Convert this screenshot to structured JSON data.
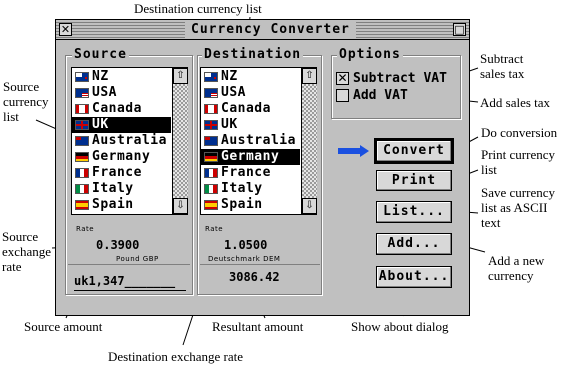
{
  "window": {
    "title": "Currency Converter",
    "close_glyph": "✕",
    "zoom_glyph": "□"
  },
  "source": {
    "label": "Source",
    "items": [
      {
        "flag": "nz-flag-icon",
        "name": "NZ"
      },
      {
        "flag": "usa-flag-icon",
        "name": "USA"
      },
      {
        "flag": "canada-flag-icon",
        "name": "Canada"
      },
      {
        "flag": "uk-flag-icon",
        "name": "UK",
        "selected": true
      },
      {
        "flag": "australia-flag-icon",
        "name": "Australia"
      },
      {
        "flag": "germany-flag-icon",
        "name": "Germany"
      },
      {
        "flag": "france-flag-icon",
        "name": "France"
      },
      {
        "flag": "italy-flag-icon",
        "name": "Italy"
      },
      {
        "flag": "spain-flag-icon",
        "name": "Spain"
      }
    ],
    "rate_label": "Rate",
    "rate_value": "0.3900",
    "currency_name": "Pound GBP",
    "amount": "uk1,347"
  },
  "destination": {
    "label": "Destination",
    "items": [
      {
        "flag": "nz-flag-icon",
        "name": "NZ"
      },
      {
        "flag": "usa-flag-icon",
        "name": "USA"
      },
      {
        "flag": "canada-flag-icon",
        "name": "Canada"
      },
      {
        "flag": "uk-flag-icon",
        "name": "UK"
      },
      {
        "flag": "australia-flag-icon",
        "name": "Australia"
      },
      {
        "flag": "germany-flag-icon",
        "name": "Germany",
        "selected": true
      },
      {
        "flag": "france-flag-icon",
        "name": "France"
      },
      {
        "flag": "italy-flag-icon",
        "name": "Italy"
      },
      {
        "flag": "spain-flag-icon",
        "name": "Spain"
      }
    ],
    "rate_label": "Rate",
    "rate_value": "1.0500",
    "currency_name": "Deutschmark DEM",
    "result": "3086.42"
  },
  "options": {
    "label": "Options",
    "subtract_vat": {
      "label": "Subtract VAT",
      "checked": true,
      "mark": "✕"
    },
    "add_vat": {
      "label": "Add VAT",
      "checked": false
    }
  },
  "buttons": {
    "convert": "Convert",
    "print": "Print",
    "list": "List...",
    "add": "Add...",
    "about": "About..."
  },
  "scroll_glyphs": {
    "up": "⇧",
    "down": "⇩"
  },
  "annotations": {
    "dest_list": "Destination currency list",
    "source_list": [
      "Source",
      "currency",
      "list"
    ],
    "subtract": [
      "Subtract",
      "sales tax"
    ],
    "add_tax": "Add sales tax",
    "do_conv": "Do conversion",
    "print_list": [
      "Print currency",
      "list"
    ],
    "save_list": [
      "Save currency",
      "list as ASCII",
      "text"
    ],
    "add_new": [
      "Add a new",
      "currency"
    ],
    "src_rate": [
      "Source",
      "exchange",
      "rate"
    ],
    "src_amount": "Source amount",
    "result_amount": "Resultant amount",
    "about_dialog": "Show about dialog",
    "dest_rate": "Destination exchange rate"
  },
  "colors": {
    "window_bg": "#c0c0c0",
    "arrow_indicator": "#1a50e0",
    "flag_red": "#cc0000",
    "flag_blue": "#002f8f"
  }
}
